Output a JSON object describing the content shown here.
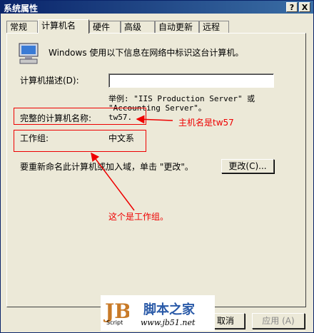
{
  "window": {
    "title": "系统属性",
    "help": "?",
    "close": "X"
  },
  "tabs": [
    "常规",
    "计算机名",
    "硬件",
    "高级",
    "自动更新",
    "远程"
  ],
  "intro": "Windows 使用以下信息在网络中标识这台计算机。",
  "description_label": "计算机描述(D):",
  "description_value": "",
  "example_line1": "举例: \"IIS Production Server\" 或",
  "example_line2": "\"Accounting Server\"。",
  "full_name_label": "完整的计算机名称:",
  "full_name_value": "tw57.",
  "workgroup_label": "工作组:",
  "workgroup_value": "中文系",
  "rename_text": "要重新命名此计算机或加入域，单击 \"更改\"。",
  "change_button": "更改(C)...",
  "annotations": {
    "hostname": "主机名是tw57",
    "workgroup": "这个是工作组。"
  },
  "footer": {
    "cancel": "取消",
    "apply": "应用 (A)"
  },
  "watermark": {
    "logo": "JB",
    "sub": "Script",
    "site_cn": "脚本之家",
    "site_url": "www.jb51.net"
  },
  "colors": {
    "annotation_red": "#e00000",
    "titlebar": "#0a246a"
  }
}
